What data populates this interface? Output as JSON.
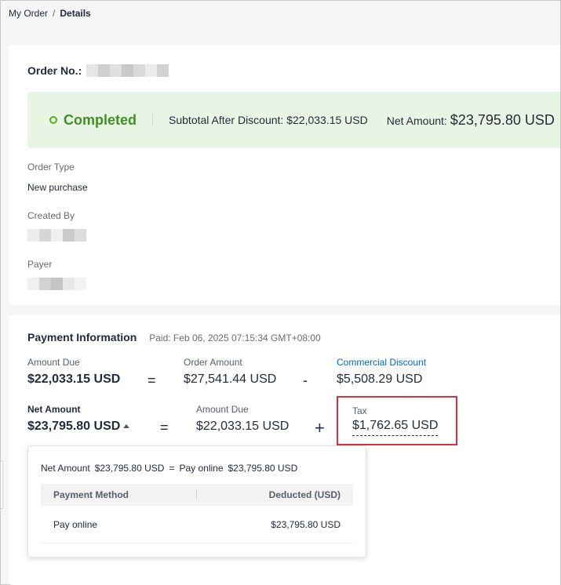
{
  "breadcrumb": {
    "root": "My Order",
    "separator": "/",
    "current": "Details"
  },
  "order": {
    "number_label": "Order No.:",
    "status": "Completed",
    "subtotal_label": "Subtotal After Discount:",
    "subtotal_value": "$22,033.15 USD",
    "net_label": "Net Amount:",
    "net_value": "$23,795.80 USD",
    "fields": [
      {
        "label": "Order Type",
        "value": "New purchase"
      },
      {
        "label": "Created By"
      },
      {
        "label": "Payer"
      }
    ]
  },
  "payment": {
    "title": "Payment Information",
    "paid": "Paid: Feb 06, 2025 07:15:34 GMT+08:00",
    "row1": {
      "due_label": "Amount Due",
      "due_value": "$22,033.15 USD",
      "eq": "=",
      "order_label": "Order Amount",
      "order_value": "$27,541.44 USD",
      "minus": "-",
      "discount_label": "Commercial Discount",
      "discount_value": "$5,508.29 USD"
    },
    "row2": {
      "net_label": "Net Amount",
      "net_value": "$23,795.80 USD",
      "eq": "=",
      "due_label": "Amount Due",
      "due_value": "$22,033.15 USD",
      "plus": "+",
      "tax_label": "Tax",
      "tax_value": "$1,762.65 USD"
    },
    "popover": {
      "net_label": "Net Amount",
      "net_value": "$23,795.80 USD",
      "eq": "=",
      "method_label": "Pay online",
      "method_value": "$23,795.80 USD",
      "table": {
        "headers": [
          "Payment Method",
          "Deducted (USD)"
        ],
        "rows": [
          {
            "method": "Pay online",
            "amount": "$23,795.80 USD"
          }
        ]
      }
    }
  },
  "colors": {
    "success": "#50b11c",
    "link": "#0067d1",
    "highlight": "#d9323a"
  }
}
